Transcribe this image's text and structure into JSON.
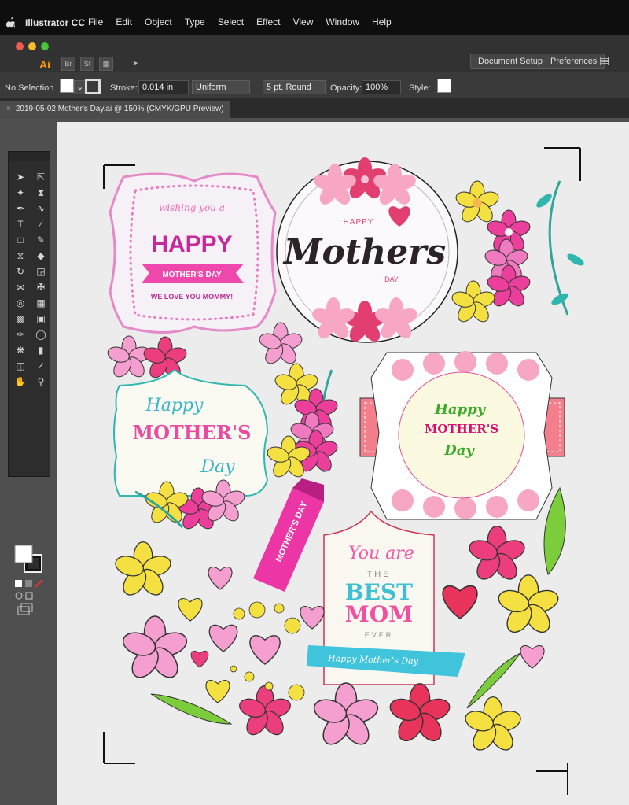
{
  "menubar": {
    "app_name": "Illustrator CC",
    "menus": [
      "File",
      "Edit",
      "Object",
      "Type",
      "Select",
      "Effect",
      "View",
      "Window",
      "Help"
    ]
  },
  "appbar": {
    "logo": "Ai",
    "bridge": "Br",
    "stock": "St",
    "document_setup": "Document Setup",
    "preferences": "Preferences"
  },
  "control": {
    "selection": "No Selection",
    "stroke_label": "Stroke:",
    "stroke_value": "0.014 in",
    "profile": "Uniform",
    "brush": "5 pt. Round",
    "opacity_label": "Opacity:",
    "opacity_value": "100%",
    "style_label": "Style:"
  },
  "document": {
    "tab_title": "2019-05-02 Mother's Day.ai @ 150% (CMYK/GPU Preview)"
  },
  "art": {
    "badge1": {
      "script": "wishing you a",
      "big": "HAPPY",
      "ribbon": "MOTHER'S DAY",
      "bottom": "WE LOVE YOU MOMMY!"
    },
    "badge2": {
      "top": "HAPPY",
      "script": "Mothers",
      "bottom": "DAY"
    },
    "badge3": {
      "script": "Happy",
      "big": "MOTHER'S",
      "bottom": "Day"
    },
    "badge4": {
      "script": "Happy",
      "big": "MOTHER'S",
      "bottom": "Day"
    },
    "ribbon": "MOTHER'S DAY",
    "badge5": {
      "script": "You are",
      "the": "THE",
      "best": "BEST",
      "mom": "MOM",
      "ever": "EVER",
      "ribbon": "Happy Mother's Day"
    }
  },
  "colors": {
    "pink": "#ec3e9b",
    "magenta": "#c51f8f",
    "teal": "#2fb7b0",
    "yellow": "#f4e041",
    "light_pink": "#f59fd0",
    "red": "#e8345a"
  }
}
